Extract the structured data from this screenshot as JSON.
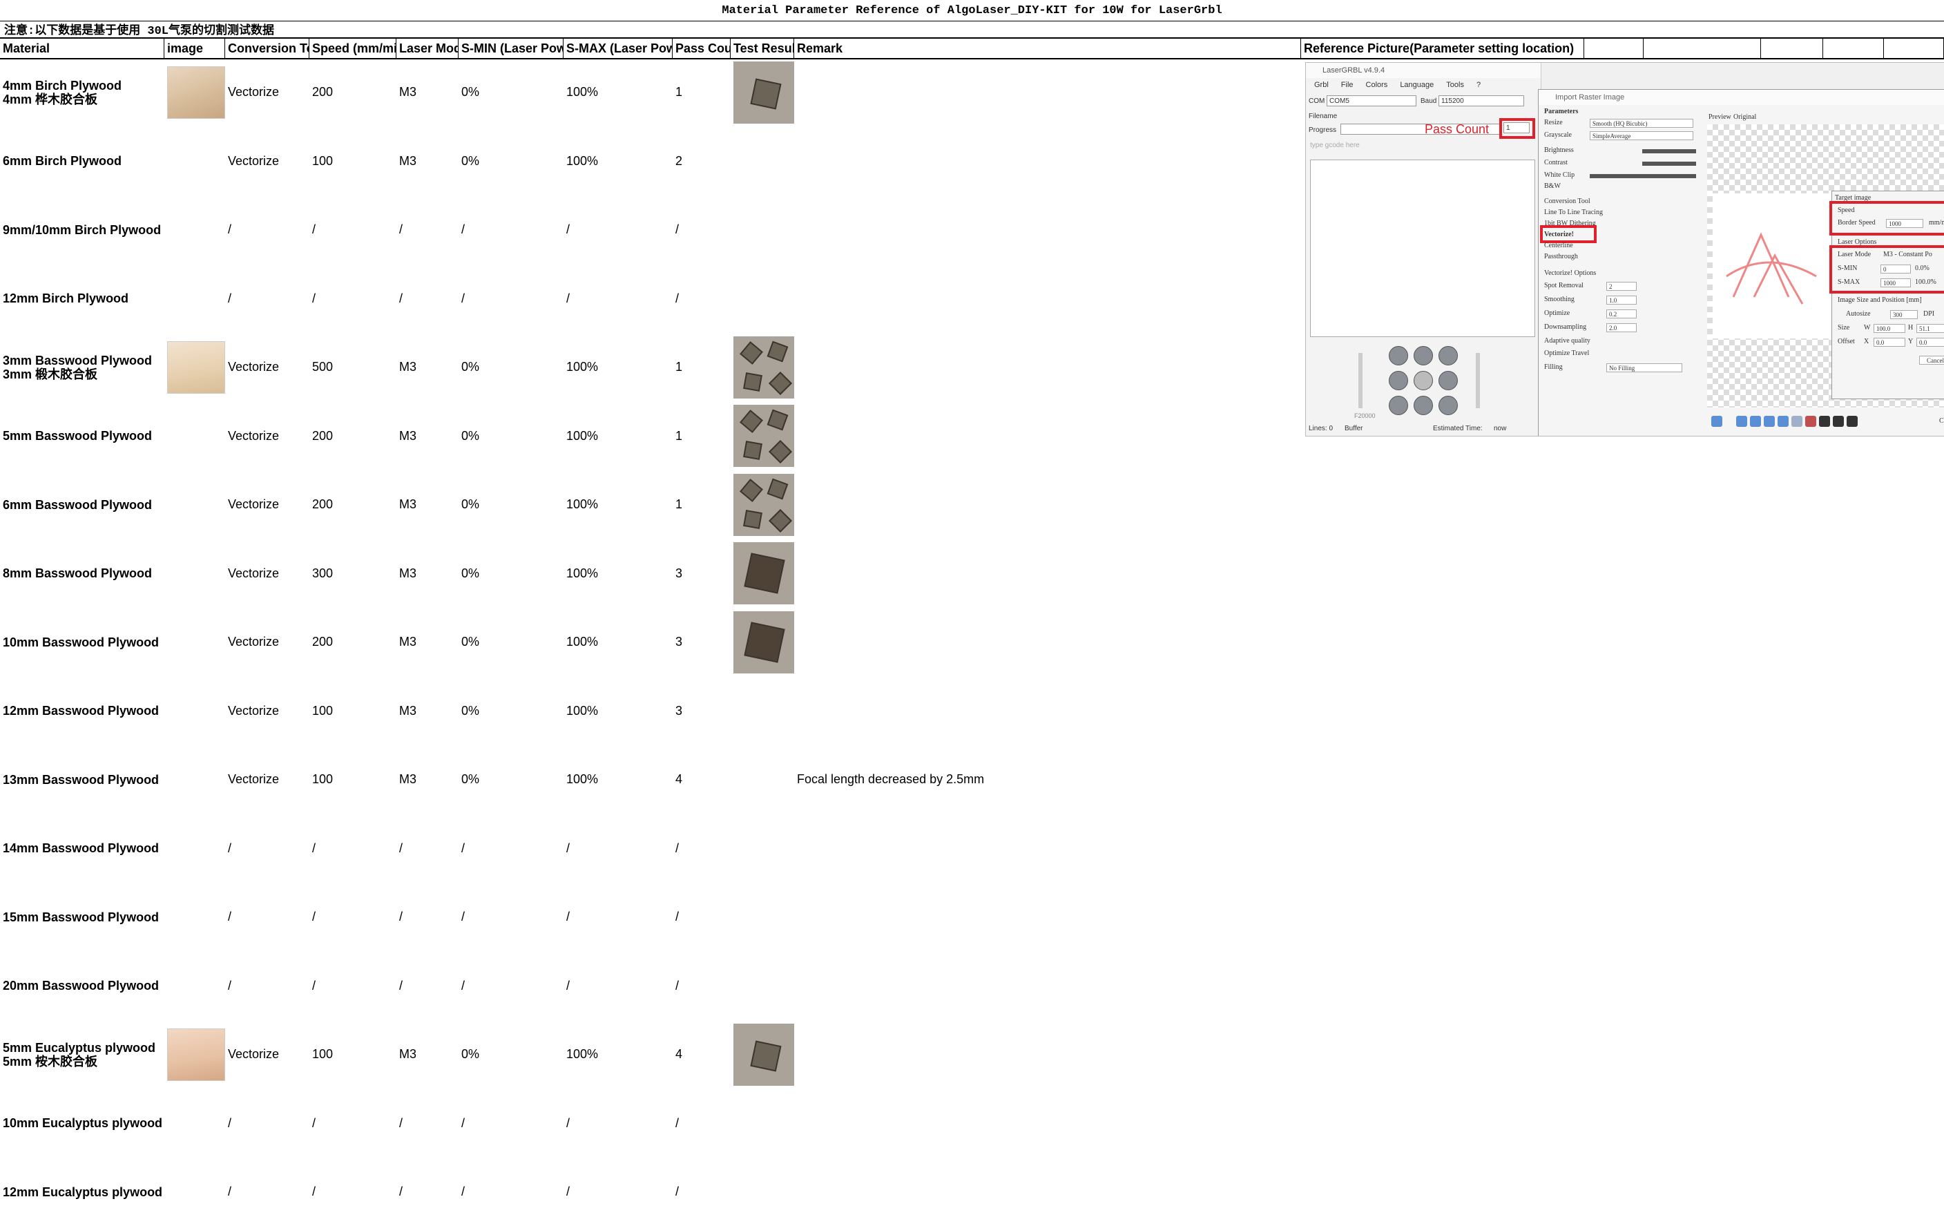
{
  "title": "Material Parameter Reference of AlgoLaser_DIY-KIT  for 10W for LaserGrbl",
  "note": "注意:以下数据是基于使用 30L气泵的切割测试数据",
  "headers": {
    "material": "Material",
    "image": "image",
    "conversion": "Conversion To",
    "speed": "Speed (mm/mi",
    "laser_mode": "Laser Mod",
    "smin": "S-MIN (Laser Pow",
    "smax": "S-MAX (Laser Pow",
    "pass": "Pass Cou",
    "test": "Test Resul",
    "remark": "Remark",
    "reference": "Reference Picture(Parameter setting location)"
  },
  "rows": [
    {
      "material": "4mm Birch Plywood",
      "material_cn": "4mm 桦木胶合板",
      "conversion": "Vectorize",
      "speed": "200",
      "mode": "M3",
      "smin": "0%",
      "smax": "100%",
      "pass": "1",
      "remark": ""
    },
    {
      "material": "6mm Birch Plywood",
      "material_cn": "",
      "conversion": "Vectorize",
      "speed": "100",
      "mode": "M3",
      "smin": "0%",
      "smax": "100%",
      "pass": "2",
      "remark": ""
    },
    {
      "material": "9mm/10mm Birch Plywood",
      "material_cn": "",
      "conversion": "/",
      "speed": "/",
      "mode": "/",
      "smin": "/",
      "smax": "/",
      "pass": "/",
      "remark": ""
    },
    {
      "material": "12mm Birch Plywood",
      "material_cn": "",
      "conversion": "/",
      "speed": "/",
      "mode": "/",
      "smin": "/",
      "smax": "/",
      "pass": "/",
      "remark": ""
    },
    {
      "material": "3mm Basswood Plywood",
      "material_cn": "3mm 椴木胶合板",
      "conversion": "Vectorize",
      "speed": "500",
      "mode": "M3",
      "smin": "0%",
      "smax": "100%",
      "pass": "1",
      "remark": ""
    },
    {
      "material": "5mm Basswood Plywood",
      "material_cn": "",
      "conversion": "Vectorize",
      "speed": "200",
      "mode": "M3",
      "smin": "0%",
      "smax": "100%",
      "pass": "1",
      "remark": ""
    },
    {
      "material": "6mm Basswood Plywood",
      "material_cn": "",
      "conversion": "Vectorize",
      "speed": "200",
      "mode": "M3",
      "smin": "0%",
      "smax": "100%",
      "pass": "1",
      "remark": ""
    },
    {
      "material": "8mm Basswood Plywood",
      "material_cn": "",
      "conversion": "Vectorize",
      "speed": "300",
      "mode": "M3",
      "smin": "0%",
      "smax": "100%",
      "pass": "3",
      "remark": ""
    },
    {
      "material": "10mm Basswood Plywood",
      "material_cn": "",
      "conversion": "Vectorize",
      "speed": "200",
      "mode": "M3",
      "smin": "0%",
      "smax": "100%",
      "pass": "3",
      "remark": ""
    },
    {
      "material": "12mm Basswood Plywood",
      "material_cn": "",
      "conversion": "Vectorize",
      "speed": "100",
      "mode": "M3",
      "smin": "0%",
      "smax": "100%",
      "pass": "3",
      "remark": ""
    },
    {
      "material": "13mm Basswood Plywood",
      "material_cn": "",
      "conversion": "Vectorize",
      "speed": "100",
      "mode": "M3",
      "smin": "0%",
      "smax": "100%",
      "pass": "4",
      "remark": "Focal length decreased by 2.5mm"
    },
    {
      "material": "14mm Basswood Plywood",
      "material_cn": "",
      "conversion": "/",
      "speed": "/",
      "mode": "/",
      "smin": "/",
      "smax": "/",
      "pass": "/",
      "remark": ""
    },
    {
      "material": "15mm Basswood Plywood",
      "material_cn": "",
      "conversion": "/",
      "speed": "/",
      "mode": "/",
      "smin": "/",
      "smax": "/",
      "pass": "/",
      "remark": ""
    },
    {
      "material": "20mm Basswood Plywood",
      "material_cn": "",
      "conversion": "/",
      "speed": "/",
      "mode": "/",
      "smin": "/",
      "smax": "/",
      "pass": "/",
      "remark": ""
    },
    {
      "material": "5mm Eucalyptus plywood",
      "material_cn": "5mm 桉木胶合板",
      "conversion": "Vectorize",
      "speed": "100",
      "mode": "M3",
      "smin": "0%",
      "smax": "100%",
      "pass": "4",
      "remark": ""
    },
    {
      "material": "10mm Eucalyptus plywood",
      "material_cn": "",
      "conversion": "/",
      "speed": "/",
      "mode": "/",
      "smin": "/",
      "smax": "/",
      "pass": "/",
      "remark": ""
    },
    {
      "material": "12mm Eucalyptus plywood",
      "material_cn": "",
      "conversion": "/",
      "speed": "/",
      "mode": "/",
      "smin": "/",
      "smax": "/",
      "pass": "/",
      "remark": ""
    }
  ],
  "reference": {
    "app_title": "LaserGRBL v4.9.4",
    "menu": [
      "Grbl",
      "File",
      "Colors",
      "Language",
      "Tools",
      "?"
    ],
    "com_label": "COM",
    "com_value": "COM5",
    "baud_label": "Baud",
    "baud_value": "115200",
    "filename_label": "Filename",
    "progress_label": "Progress",
    "pass_count_annotation": "Pass Count",
    "pass_count_value": "1",
    "gcode_hint": "type gcode here",
    "lines_label": "Lines: 0",
    "buffer_label": "Buffer",
    "estimated_label": "Estimated Time:",
    "estimated_value": "now",
    "feed_label": "F20000",
    "import_title": "Import Raster Image",
    "parameters_label": "Parameters",
    "resize_label": "Resize",
    "resize_value": "Smooth (HQ Bicubic)",
    "grayscale_label": "Grayscale",
    "grayscale_value": "SimpleAverage",
    "brightness_label": "Brightness",
    "contrast_label": "Contrast",
    "whiteclip_label": "White Clip",
    "bw_label": "B&W",
    "conversion_tool_label": "Conversion Tool",
    "tool_options": [
      "Line To Line Tracing",
      "1bit BW Dithering",
      "Vectorize!",
      "Centerline",
      "Passthrough"
    ],
    "vectorize_options_label": "Vectorize! Options",
    "spot_removal_label": "Spot Removal",
    "spot_removal_value": "2",
    "smoothing_label": "Smoothing",
    "smoothing_value": "1.0",
    "optimize_label": "Optimize",
    "optimize_value": "0.2",
    "downsampling_label": "Downsampling",
    "downsampling_value": "2.0",
    "adaptive_label": "Adaptive quality",
    "optimize_travel_label": "Optimize Travel",
    "filling_label": "Filling",
    "filling_value": "No Filling",
    "preview_label": "Preview",
    "original_label": "Original",
    "target_image_label": "Target image",
    "speed_label": "Speed",
    "border_speed_label": "Border Speed",
    "border_speed_value": "1000",
    "speed_unit": "mm/mi",
    "laser_options_label": "Laser Options",
    "laser_mode_label": "Laser Mode",
    "laser_mode_value": "M3 - Constant Po",
    "smin_label": "S-MIN",
    "smin_value": "0",
    "smin_pct": "0.0%",
    "smax_label": "S-MAX",
    "smax_value": "1000",
    "smax_pct": "100.0%",
    "size_pos_label": "Image Size and Position [mm]",
    "autosize_label": "Autosize",
    "autosize_value": "300",
    "dpi_label": "DPI",
    "size_label": "Size",
    "w_label": "W",
    "w_value": "100.0",
    "h_label": "H",
    "h_value": "51.1",
    "offset_label": "Offset",
    "x_label": "X",
    "x_value": "0.0",
    "y_label": "Y",
    "y_value": "0.0",
    "cancel_label": "Cancel",
    "ok_label": "Ca"
  },
  "colors": {
    "annotation_red": "#e0202a",
    "grid": "#000000"
  }
}
